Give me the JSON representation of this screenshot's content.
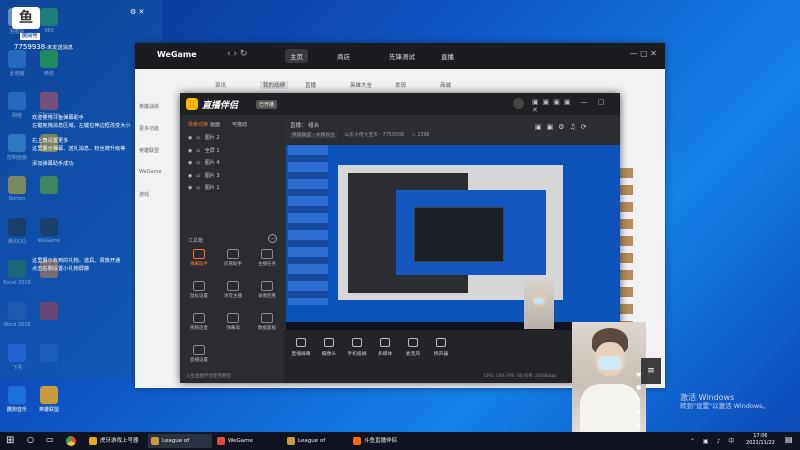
{
  "desktop_icons": [
    {
      "label": "回收站",
      "color": "#c9d4e6"
    },
    {
      "label": "此电脑",
      "color": "#3a7bd5"
    },
    {
      "label": "网络",
      "color": "#3a7bd5"
    },
    {
      "label": "控制面板",
      "color": "#4aa1e0"
    },
    {
      "label": "Norton",
      "color": "#f3c200"
    },
    {
      "label": "腾讯QQ",
      "color": "#1e1e1e"
    },
    {
      "label": "Excel 2016",
      "color": "#1d7a3e"
    },
    {
      "label": "Word 2016",
      "color": "#2b5bb5"
    },
    {
      "label": "飞书",
      "color": "#3370ff"
    },
    {
      "label": "酷狗音乐",
      "color": "#1a6fd9"
    }
  ],
  "desktop_icons_col2": [
    {
      "label": "360",
      "color": "#28a745"
    },
    {
      "label": "微信",
      "color": "#2dc100"
    },
    {
      "label": "Chrome",
      "color": "#e6453a"
    },
    {
      "label": "",
      "color": "#f2b600"
    },
    {
      "label": "",
      "color": "#76b900"
    },
    {
      "label": "WeGame",
      "color": "#222"
    },
    {
      "label": "",
      "color": "#e9842b"
    },
    {
      "label": "",
      "color": "#cc3333"
    },
    {
      "label": "",
      "color": "#2466d8"
    },
    {
      "label": "英雄联盟",
      "color": "#c89b3c"
    }
  ],
  "overlay": {
    "channel_tag": "房间号",
    "room_no": "7759938",
    "room_suffix": "-未友送消息",
    "msg1": "欢迎使用斗鱼弹幕助手",
    "msg2": "左键拖拽消息区域，左键拉伸边框改变大小",
    "msg3": "右上角设置更多",
    "msg4": "这里展示弹幕、送礼消息、粉丝牌升级等",
    "msg5": "添加弹幕助手成功",
    "msg6": "这里展示收到的礼物、道具、贵族开通",
    "msg7": "点击右侧设置小礼物屏蔽"
  },
  "wegame": {
    "logo": "WeGame",
    "tabs": [
      "主页",
      "商店",
      "先锋测试",
      "直播"
    ],
    "subnav": [
      "资讯",
      "我的战绩",
      "直播",
      "英雄大全",
      "发现",
      "商城"
    ],
    "left_items": [
      "英雄战绩",
      "更多功能",
      "英雄联盟",
      "WeGame",
      "游戏"
    ]
  },
  "douyu": {
    "title": "直播伴侣",
    "badge": "已开播",
    "scene_tabs": [
      "场景切换",
      "画面",
      "可拖动"
    ],
    "scenes": [
      "图片 2",
      "全屏 1",
      "图片 4",
      "图片 3",
      "图片 1"
    ],
    "stream_title_label": "直播：",
    "stream_title": "组合",
    "stream_category": "英雄联盟 · 大师段位",
    "room_info": "山东大佬大宝贝 · 7759938",
    "viewers": "2396",
    "tools_header": "工具箱",
    "tools": [
      "弹幕助手",
      "房管助手",
      "主播任务",
      "鼠标设置",
      "语音主播",
      "录像回看",
      "视频连麦",
      "弹幕墙",
      "数据面板",
      "直播设置"
    ],
    "bottom_buttons": [
      "直播屏幕",
      "摄像头",
      "手机投屏",
      "多媒体",
      "麦克风",
      "扬声器"
    ],
    "status_left": "斗鱼直播伴侣使用教程",
    "status_right": "CPU: 14%  FPS: 60  码率: 2000kbps"
  },
  "taskbar": {
    "items": [
      {
        "label": "虎牙游戏上号器",
        "color": "#e6a623"
      },
      {
        "label": "League of Legends",
        "color": "#c89b3c"
      },
      {
        "label": "WeGame",
        "color": "#e64a3a"
      },
      {
        "label": "League of Legen...",
        "color": "#c89b3c"
      },
      {
        "label": "斗鱼直播伴侣",
        "color": "#ff6a00"
      }
    ],
    "time": "17:06",
    "date": "2021/11/22"
  },
  "activation": {
    "line1": "激活 Windows",
    "line2": "转到\"设置\"以激活 Windows。"
  }
}
